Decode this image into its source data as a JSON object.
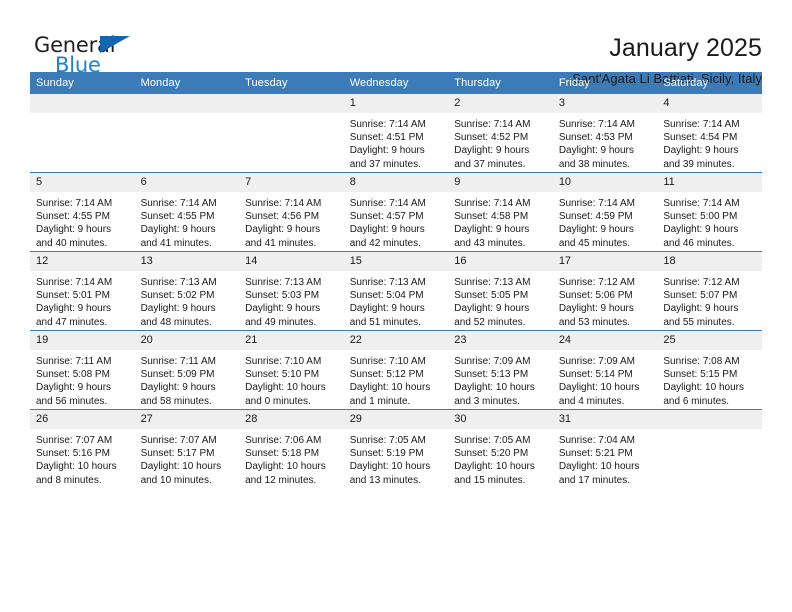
{
  "logo": {
    "word_one": "General",
    "word_two": "Blue",
    "triangle_color": "#1565b0",
    "blue_text_color": "#1f7fd4"
  },
  "header": {
    "title": "January 2025",
    "subtitle": "Sant'Agata Li Battiati, Sicily, Italy"
  },
  "theme": {
    "header_blue": "#3b7cb8",
    "daynum_gray": "#efefef"
  },
  "weekday_headers": [
    "Sunday",
    "Monday",
    "Tuesday",
    "Wednesday",
    "Thursday",
    "Friday",
    "Saturday"
  ],
  "weeks": [
    [
      {
        "day": "",
        "lines": []
      },
      {
        "day": "",
        "lines": []
      },
      {
        "day": "",
        "lines": []
      },
      {
        "day": "1",
        "lines": [
          "Sunrise: 7:14 AM",
          "Sunset: 4:51 PM",
          "Daylight: 9 hours",
          "and 37 minutes."
        ]
      },
      {
        "day": "2",
        "lines": [
          "Sunrise: 7:14 AM",
          "Sunset: 4:52 PM",
          "Daylight: 9 hours",
          "and 37 minutes."
        ]
      },
      {
        "day": "3",
        "lines": [
          "Sunrise: 7:14 AM",
          "Sunset: 4:53 PM",
          "Daylight: 9 hours",
          "and 38 minutes."
        ]
      },
      {
        "day": "4",
        "lines": [
          "Sunrise: 7:14 AM",
          "Sunset: 4:54 PM",
          "Daylight: 9 hours",
          "and 39 minutes."
        ]
      }
    ],
    [
      {
        "day": "5",
        "lines": [
          "Sunrise: 7:14 AM",
          "Sunset: 4:55 PM",
          "Daylight: 9 hours",
          "and 40 minutes."
        ]
      },
      {
        "day": "6",
        "lines": [
          "Sunrise: 7:14 AM",
          "Sunset: 4:55 PM",
          "Daylight: 9 hours",
          "and 41 minutes."
        ]
      },
      {
        "day": "7",
        "lines": [
          "Sunrise: 7:14 AM",
          "Sunset: 4:56 PM",
          "Daylight: 9 hours",
          "and 41 minutes."
        ]
      },
      {
        "day": "8",
        "lines": [
          "Sunrise: 7:14 AM",
          "Sunset: 4:57 PM",
          "Daylight: 9 hours",
          "and 42 minutes."
        ]
      },
      {
        "day": "9",
        "lines": [
          "Sunrise: 7:14 AM",
          "Sunset: 4:58 PM",
          "Daylight: 9 hours",
          "and 43 minutes."
        ]
      },
      {
        "day": "10",
        "lines": [
          "Sunrise: 7:14 AM",
          "Sunset: 4:59 PM",
          "Daylight: 9 hours",
          "and 45 minutes."
        ]
      },
      {
        "day": "11",
        "lines": [
          "Sunrise: 7:14 AM",
          "Sunset: 5:00 PM",
          "Daylight: 9 hours",
          "and 46 minutes."
        ]
      }
    ],
    [
      {
        "day": "12",
        "lines": [
          "Sunrise: 7:14 AM",
          "Sunset: 5:01 PM",
          "Daylight: 9 hours",
          "and 47 minutes."
        ]
      },
      {
        "day": "13",
        "lines": [
          "Sunrise: 7:13 AM",
          "Sunset: 5:02 PM",
          "Daylight: 9 hours",
          "and 48 minutes."
        ]
      },
      {
        "day": "14",
        "lines": [
          "Sunrise: 7:13 AM",
          "Sunset: 5:03 PM",
          "Daylight: 9 hours",
          "and 49 minutes."
        ]
      },
      {
        "day": "15",
        "lines": [
          "Sunrise: 7:13 AM",
          "Sunset: 5:04 PM",
          "Daylight: 9 hours",
          "and 51 minutes."
        ]
      },
      {
        "day": "16",
        "lines": [
          "Sunrise: 7:13 AM",
          "Sunset: 5:05 PM",
          "Daylight: 9 hours",
          "and 52 minutes."
        ]
      },
      {
        "day": "17",
        "lines": [
          "Sunrise: 7:12 AM",
          "Sunset: 5:06 PM",
          "Daylight: 9 hours",
          "and 53 minutes."
        ]
      },
      {
        "day": "18",
        "lines": [
          "Sunrise: 7:12 AM",
          "Sunset: 5:07 PM",
          "Daylight: 9 hours",
          "and 55 minutes."
        ]
      }
    ],
    [
      {
        "day": "19",
        "lines": [
          "Sunrise: 7:11 AM",
          "Sunset: 5:08 PM",
          "Daylight: 9 hours",
          "and 56 minutes."
        ]
      },
      {
        "day": "20",
        "lines": [
          "Sunrise: 7:11 AM",
          "Sunset: 5:09 PM",
          "Daylight: 9 hours",
          "and 58 minutes."
        ]
      },
      {
        "day": "21",
        "lines": [
          "Sunrise: 7:10 AM",
          "Sunset: 5:10 PM",
          "Daylight: 10 hours",
          "and 0 minutes."
        ]
      },
      {
        "day": "22",
        "lines": [
          "Sunrise: 7:10 AM",
          "Sunset: 5:12 PM",
          "Daylight: 10 hours",
          "and 1 minute."
        ]
      },
      {
        "day": "23",
        "lines": [
          "Sunrise: 7:09 AM",
          "Sunset: 5:13 PM",
          "Daylight: 10 hours",
          "and 3 minutes."
        ]
      },
      {
        "day": "24",
        "lines": [
          "Sunrise: 7:09 AM",
          "Sunset: 5:14 PM",
          "Daylight: 10 hours",
          "and 4 minutes."
        ]
      },
      {
        "day": "25",
        "lines": [
          "Sunrise: 7:08 AM",
          "Sunset: 5:15 PM",
          "Daylight: 10 hours",
          "and 6 minutes."
        ]
      }
    ],
    [
      {
        "day": "26",
        "lines": [
          "Sunrise: 7:07 AM",
          "Sunset: 5:16 PM",
          "Daylight: 10 hours",
          "and 8 minutes."
        ]
      },
      {
        "day": "27",
        "lines": [
          "Sunrise: 7:07 AM",
          "Sunset: 5:17 PM",
          "Daylight: 10 hours",
          "and 10 minutes."
        ]
      },
      {
        "day": "28",
        "lines": [
          "Sunrise: 7:06 AM",
          "Sunset: 5:18 PM",
          "Daylight: 10 hours",
          "and 12 minutes."
        ]
      },
      {
        "day": "29",
        "lines": [
          "Sunrise: 7:05 AM",
          "Sunset: 5:19 PM",
          "Daylight: 10 hours",
          "and 13 minutes."
        ]
      },
      {
        "day": "30",
        "lines": [
          "Sunrise: 7:05 AM",
          "Sunset: 5:20 PM",
          "Daylight: 10 hours",
          "and 15 minutes."
        ]
      },
      {
        "day": "31",
        "lines": [
          "Sunrise: 7:04 AM",
          "Sunset: 5:21 PM",
          "Daylight: 10 hours",
          "and 17 minutes."
        ]
      },
      {
        "day": "",
        "lines": []
      }
    ]
  ]
}
